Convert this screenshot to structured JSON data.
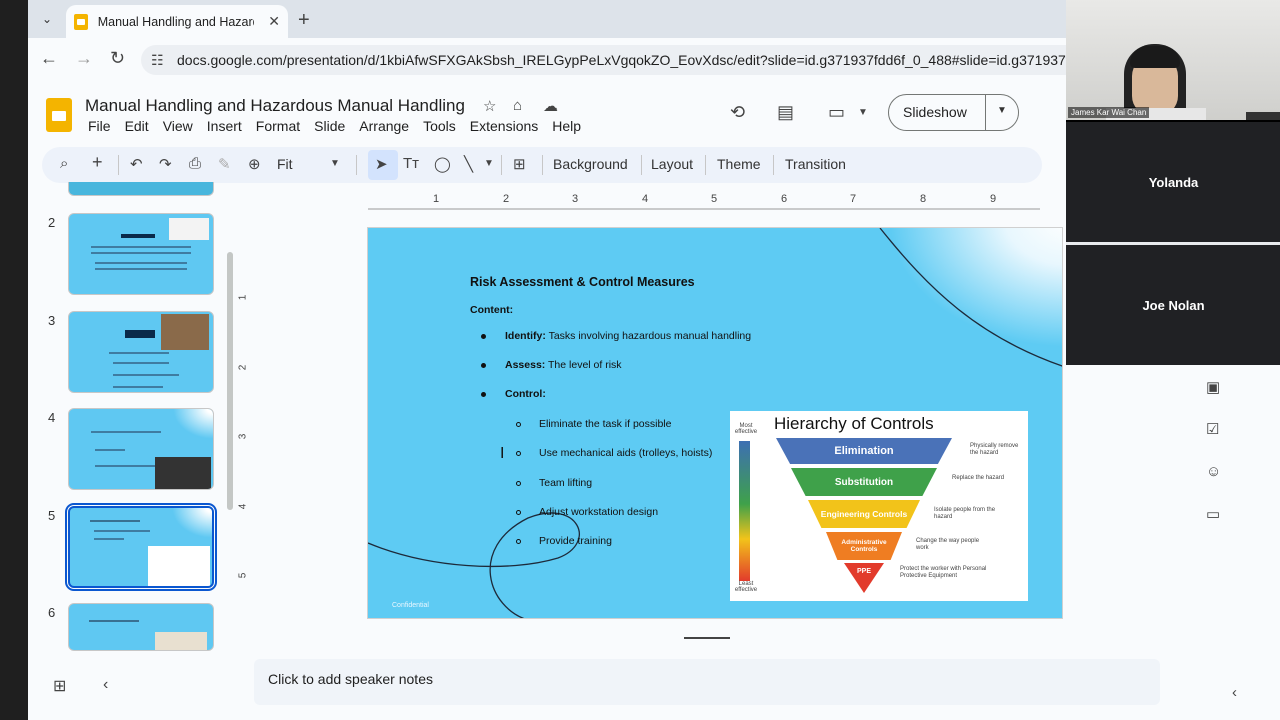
{
  "browser": {
    "tab_title": "Manual Handling and Hazardous",
    "url": "docs.google.com/presentation/d/1kbiAfwSFXGAkSbsh_IRELGypPeLxVgqokZO_EovXdsc/edit?slide=id.g371937fdd6f_0_488#slide=id.g371937fdd6f"
  },
  "docs": {
    "title": "Manual Handling and Hazardous Manual Handling",
    "menu": [
      "File",
      "Edit",
      "View",
      "Insert",
      "Format",
      "Slide",
      "Arrange",
      "Tools",
      "Extensions",
      "Help"
    ],
    "slideshow_label": "Slideshow"
  },
  "toolbar": {
    "zoom": "Fit",
    "background": "Background",
    "layout": "Layout",
    "theme": "Theme",
    "transition": "Transition"
  },
  "filmstrip": {
    "slides": [
      {
        "num": "2"
      },
      {
        "num": "3"
      },
      {
        "num": "4"
      },
      {
        "num": "5"
      },
      {
        "num": "6"
      }
    ]
  },
  "ruler": {
    "h": [
      "1",
      "2",
      "3",
      "4",
      "5",
      "6",
      "7",
      "8",
      "9"
    ],
    "v": [
      "1",
      "2",
      "3",
      "4",
      "5"
    ]
  },
  "slide": {
    "heading": "Risk Assessment & Control Measures",
    "content_label": "Content:",
    "identify_label": "Identify:",
    "identify_text": " Tasks involving hazardous manual handling",
    "assess_label": "Assess:",
    "assess_text": " The level of risk",
    "control_label": "Control:",
    "controls": [
      "Eliminate the task if possible",
      "Use mechanical aids (trolleys, hoists)",
      "Team lifting",
      "Adjust workstation design",
      "Provide training"
    ],
    "footer": "Confidential"
  },
  "hierarchy": {
    "title": "Hierarchy of Controls",
    "most": "Most effective",
    "least": "Least effective",
    "tiers": [
      {
        "label": "Elimination",
        "note": "Physically remove the hazard",
        "color": "#4a72b8"
      },
      {
        "label": "Substitution",
        "note": "Replace the hazard",
        "color": "#3fa14a"
      },
      {
        "label": "Engineering Controls",
        "note": "Isolate people from the hazard",
        "color": "#f2c31a"
      },
      {
        "label": "Administrative Controls",
        "note": "Change the way people work",
        "color": "#ef7d22"
      },
      {
        "label": "PPE",
        "note": "Protect the worker with Personal Protective Equipment",
        "color": "#e23b2c"
      }
    ]
  },
  "notes": {
    "placeholder": "Click to add speaker notes"
  },
  "video": {
    "self_name": "James Kar Wai Chan",
    "participants": [
      "Yolanda",
      "Joe Nolan"
    ]
  }
}
